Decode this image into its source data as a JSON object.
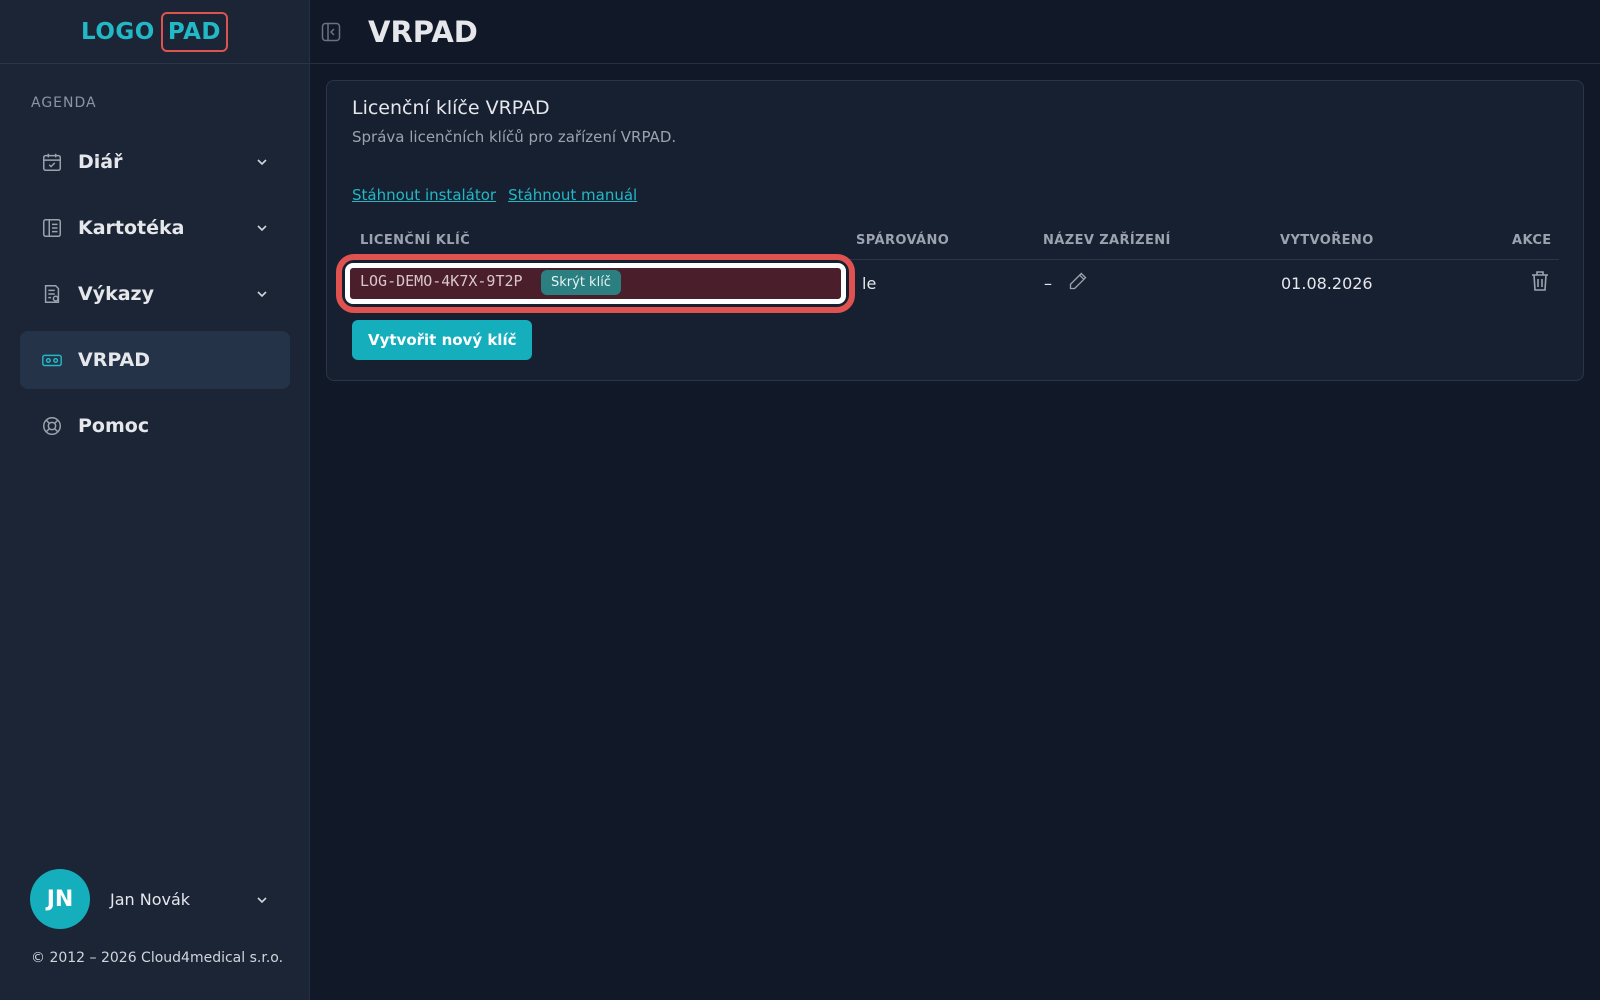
{
  "logo": {
    "part1": "LOGO",
    "part2": "PAD"
  },
  "sidebar": {
    "section_label": "AGENDA",
    "items": [
      {
        "label": "Diář",
        "icon": "calendar-icon",
        "has_chevron": true
      },
      {
        "label": "Kartotéka",
        "icon": "book-icon",
        "has_chevron": true
      },
      {
        "label": "Výkazy",
        "icon": "report-icon",
        "has_chevron": true
      },
      {
        "label": "VRPAD",
        "icon": "vr-headset-icon",
        "active": true
      },
      {
        "label": "Pomoc",
        "icon": "lifebuoy-icon"
      }
    ],
    "user": {
      "initials": "JN",
      "name": "Jan Novák"
    },
    "copyright": "© 2012 – 2026 Cloud4medical s.r.o."
  },
  "header": {
    "title": "VRPAD"
  },
  "card": {
    "title": "Licenční klíče VRPAD",
    "subtitle": "Správa licenčních klíčů pro zařízení VRPAD.",
    "links": {
      "installer": "Stáhnout instalátor",
      "manual": "Stáhnout manuál"
    },
    "columns": {
      "key": "LICENČNÍ KLÍČ",
      "paired": "SPÁROVÁNO",
      "device": "NÁZEV ZAŘÍZENÍ",
      "created": "VYTVOŘENO",
      "actions": "AKCE"
    },
    "row": {
      "key": "LOG-DEMO-4K7X-9T2P",
      "hide_label": "Skrýt klíč",
      "paired": "le",
      "device": "–",
      "created": "01.08.2026"
    },
    "create_button": "Vytvořit nový klíč"
  },
  "colors": {
    "accent": "#14aebd",
    "highlight": "#e0524f",
    "background": "#111827",
    "sidebar": "#1c2536"
  }
}
